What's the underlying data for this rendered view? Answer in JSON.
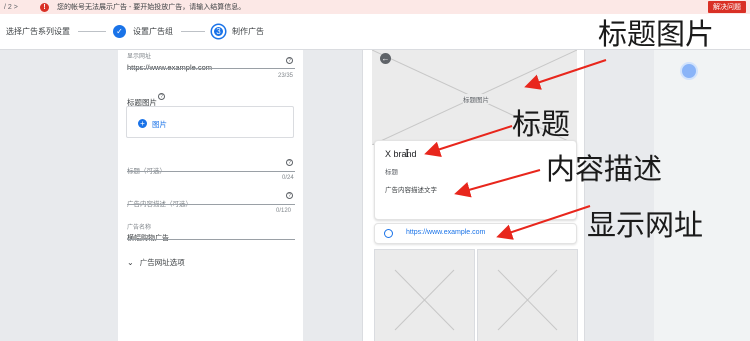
{
  "banner": {
    "nav": "/ 2  >",
    "warn_icon": "!",
    "message": "您的帐号无法展示广告 - 要开始投放广告，请输入结算信息。",
    "fix_label": "解决问题"
  },
  "stepper": {
    "steps": [
      {
        "label": "选择广告系列设置",
        "icon": "✓"
      },
      {
        "label": "设置广告组",
        "icon": "✓"
      },
      {
        "label": "制作广告",
        "icon": "3"
      }
    ]
  },
  "form": {
    "final_url": {
      "label": "显示网址",
      "value": "https://www.example.com",
      "count": "23/35",
      "help": "?"
    },
    "header_image": {
      "label": "标题图片",
      "help": "?",
      "add_label": "图片",
      "plus": "+"
    },
    "headline": {
      "placeholder": "标题（可选）",
      "count": "0/24",
      "help": "?"
    },
    "description": {
      "placeholder": "广告内容描述（可选）",
      "count": "0/120",
      "help": "?"
    },
    "ad_name": {
      "label": "广告名称",
      "value": "横幅购物广告"
    },
    "url_options": {
      "label": "广告网址选项",
      "chevron": "⌄"
    }
  },
  "preview": {
    "hero_label": "标题图片",
    "back_icon": "←",
    "brand": "X brand",
    "cursor": "I",
    "headline": "标题",
    "description": "广告内容描述文字",
    "url": "https://www.example.com"
  },
  "annotations": {
    "image": "标题图片",
    "headline": "标题",
    "description": "内容描述",
    "url": "显示网址"
  },
  "colors": {
    "accent": "#1a73e8",
    "error": "#d93025",
    "arrow": "#e8261c"
  }
}
